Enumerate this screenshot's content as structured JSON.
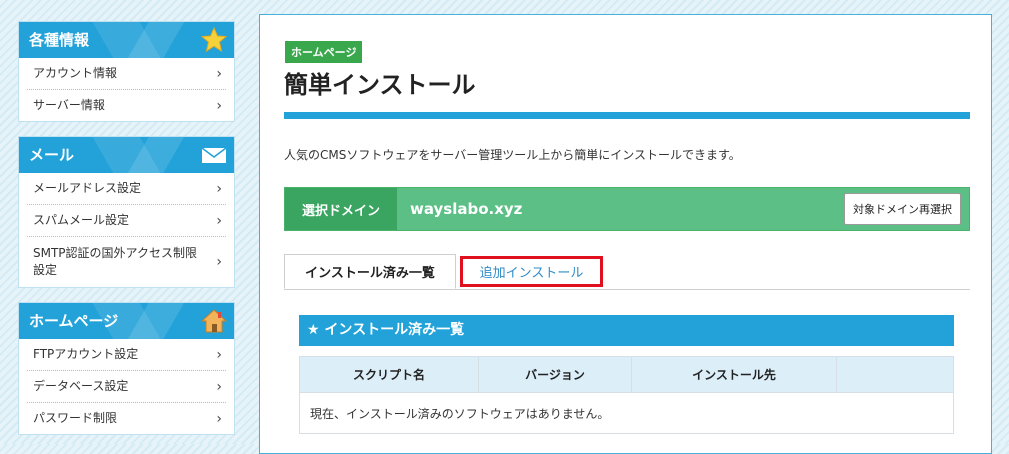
{
  "sidebar": {
    "sections": [
      {
        "title": "各種情報",
        "icon": "star-icon",
        "items": [
          "アカウント情報",
          "サーバー情報"
        ]
      },
      {
        "title": "メール",
        "icon": "envelope-icon",
        "items": [
          "メールアドレス設定",
          "スパムメール設定",
          "SMTP認証の国外アクセス制限設定"
        ]
      },
      {
        "title": "ホームページ",
        "icon": "house-icon",
        "items": [
          "FTPアカウント設定",
          "データベース設定",
          "パスワード制限"
        ]
      }
    ]
  },
  "main": {
    "badge": "ホームページ",
    "title": "簡単インストール",
    "description": "人気のCMSソフトウェアをサーバー管理ツール上から簡単にインストールできます。",
    "domain": {
      "label": "選択ドメイン",
      "value": "wayslabo.xyz",
      "reselect_button": "対象ドメイン再選択"
    },
    "tabs": {
      "installed": "インストール済み一覧",
      "add": "追加インストール"
    },
    "panel": {
      "heading": "★ インストール済み一覧",
      "columns": [
        "スクリプト名",
        "バージョン",
        "インストール先",
        ""
      ],
      "empty_message": "現在、インストール済みのソフトウェアはありません。"
    }
  },
  "colors": {
    "accent_blue": "#22a2d8",
    "domain_green": "#5cc086",
    "badge_green": "#39a84d",
    "highlight_red": "#e0101e"
  }
}
